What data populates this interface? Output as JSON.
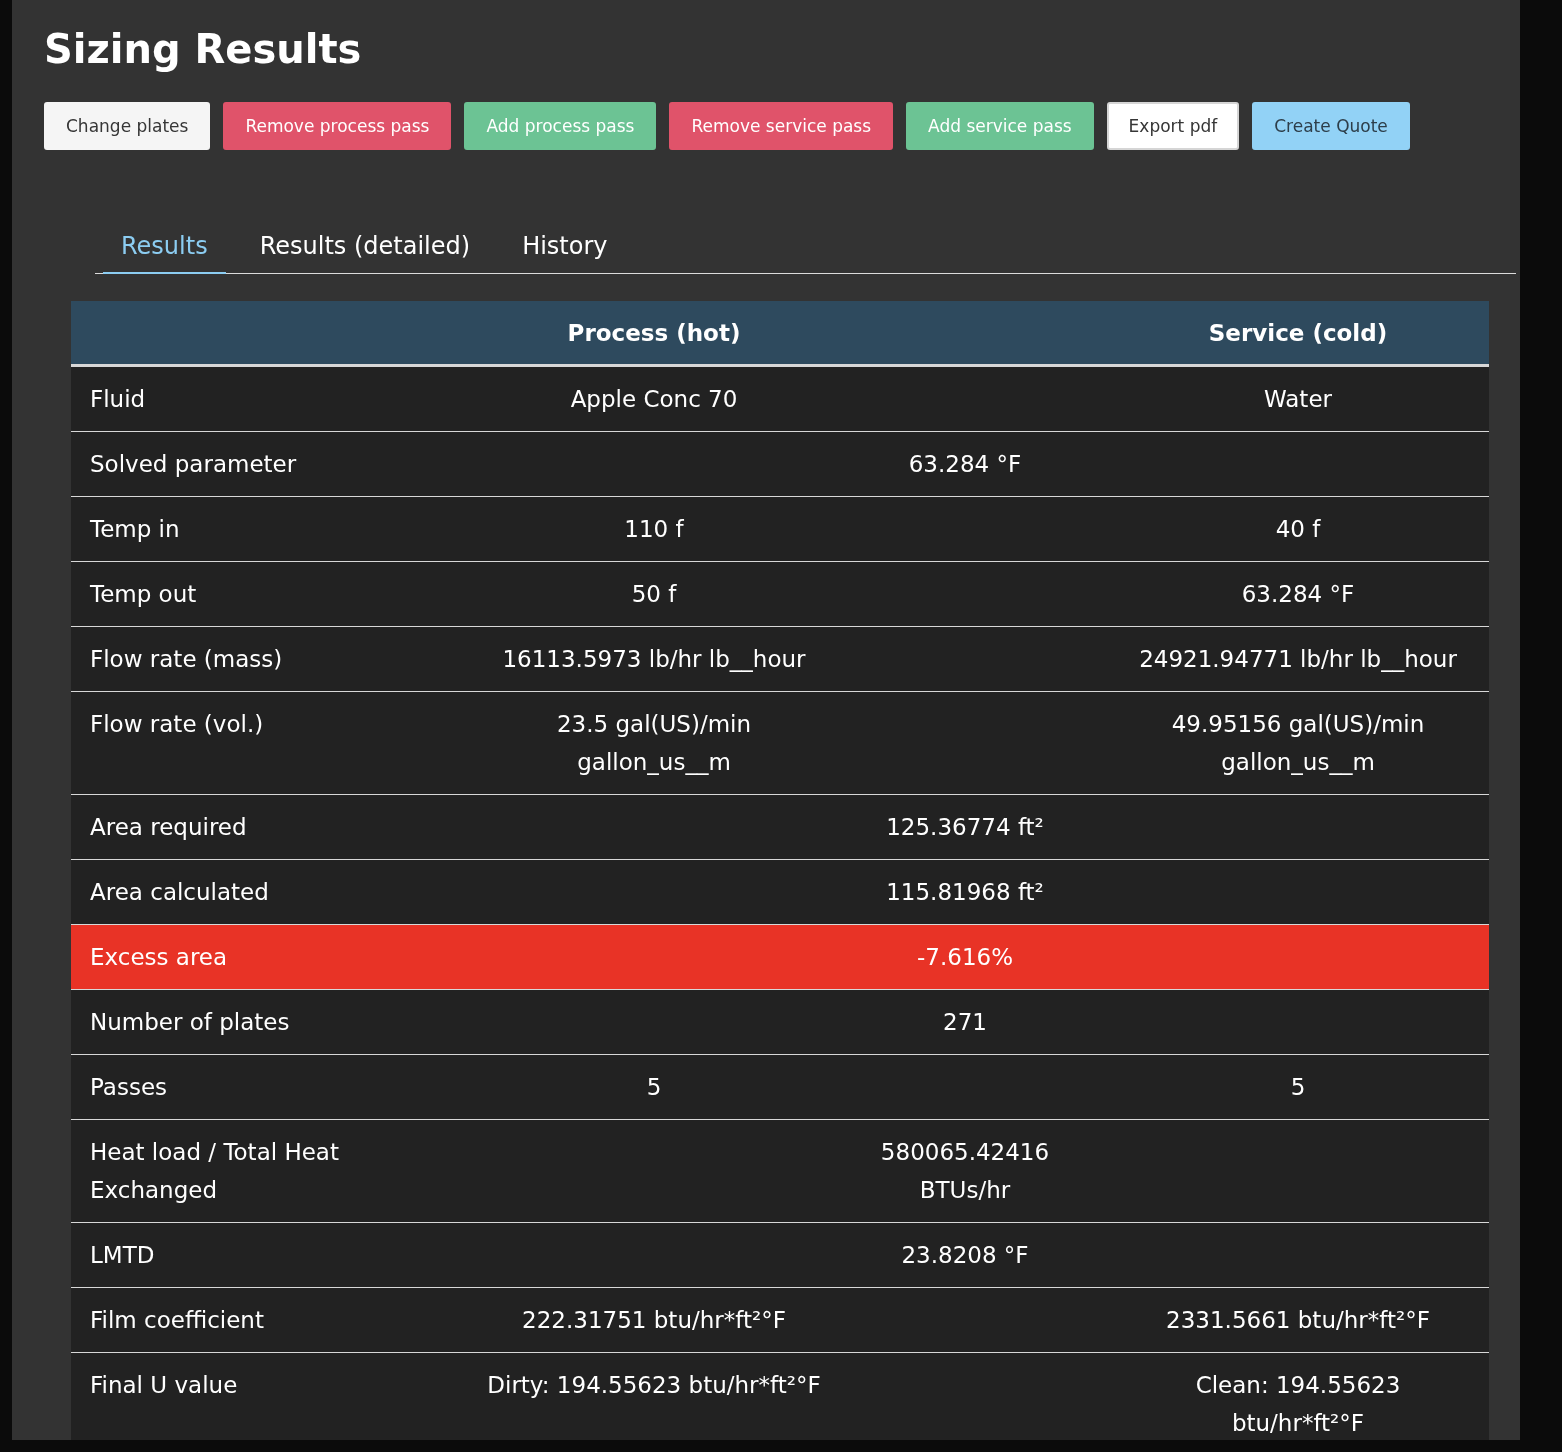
{
  "title": "Sizing Results",
  "buttons": [
    {
      "label": "Change plates",
      "kind": "light"
    },
    {
      "label": "Remove process pass",
      "kind": "danger"
    },
    {
      "label": "Add process pass",
      "kind": "success"
    },
    {
      "label": "Remove service pass",
      "kind": "danger"
    },
    {
      "label": "Add service pass",
      "kind": "success"
    },
    {
      "label": "Export pdf",
      "kind": "outline"
    },
    {
      "label": "Create Quote",
      "kind": "info"
    }
  ],
  "tabs": [
    {
      "label": "Results",
      "selected": true
    },
    {
      "label": "Results (detailed)",
      "selected": false
    },
    {
      "label": "History",
      "selected": false
    }
  ],
  "table": {
    "columns": [
      "Process (hot)",
      "Service (cold)"
    ],
    "rows": [
      {
        "kind": "split",
        "label": "Fluid",
        "process": "Apple Conc 70",
        "service": "Water",
        "highlighted": false
      },
      {
        "kind": "span",
        "label": "Solved parameter",
        "value": "63.284 °F",
        "highlighted": false
      },
      {
        "kind": "split",
        "label": "Temp in",
        "process": "110 f",
        "service": "40 f",
        "highlighted": false
      },
      {
        "kind": "split",
        "label": "Temp out",
        "process": "50 f",
        "service": "63.284 °F",
        "highlighted": false
      },
      {
        "kind": "split",
        "label": "Flow rate (mass)",
        "process": "16113.5973 lb/hr lb__hour",
        "service": "24921.94771 lb/hr lb__hour",
        "highlighted": false
      },
      {
        "kind": "split",
        "label": "Flow rate (vol.)",
        "process": "23.5 gal(US)/min gallon_us__m",
        "service": "49.95156 gal(US)/min gallon_us__m",
        "highlighted": false
      },
      {
        "kind": "span",
        "label": "Area required",
        "value": "125.36774 ft²",
        "highlighted": false
      },
      {
        "kind": "span",
        "label": "Area calculated",
        "value": "115.81968 ft²",
        "highlighted": false
      },
      {
        "kind": "span",
        "label": "Excess area",
        "value": "-7.616%",
        "highlighted": true
      },
      {
        "kind": "span",
        "label": "Number of plates",
        "value": "271",
        "highlighted": false
      },
      {
        "kind": "split",
        "label": "Passes",
        "process": "5",
        "service": "5",
        "highlighted": false
      },
      {
        "kind": "span",
        "label": "Heat load / Total Heat Exchanged",
        "value": "580065.42416 BTUs/hr",
        "highlighted": false
      },
      {
        "kind": "span",
        "label": "LMTD",
        "value": "23.8208 °F",
        "highlighted": false
      },
      {
        "kind": "split",
        "label": "Film coefficient",
        "process": "222.31751 btu/hr*ft²°F",
        "service": "2331.5661 btu/hr*ft²°F",
        "highlighted": false
      },
      {
        "kind": "split",
        "label": "Final U value",
        "process": "Dirty: 194.55623 btu/hr*ft²°F",
        "service": "Clean: 194.55623 btu/hr*ft²°F",
        "highlighted": false
      }
    ]
  }
}
